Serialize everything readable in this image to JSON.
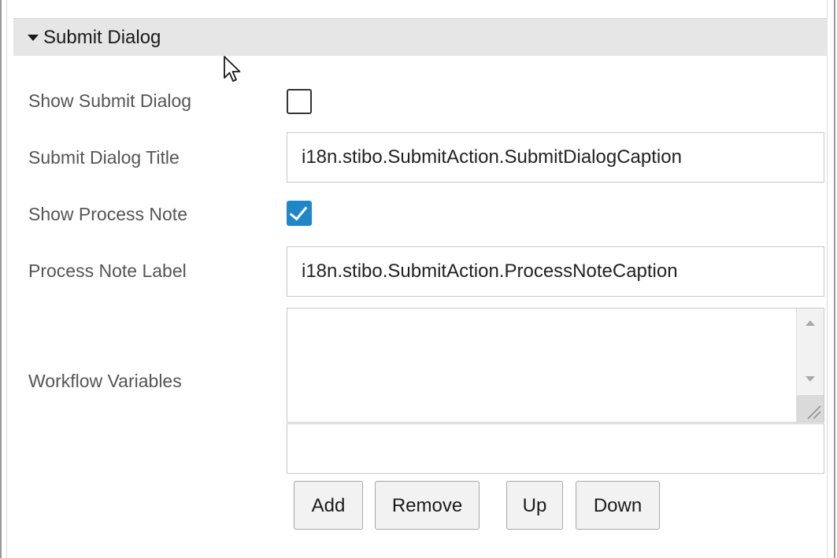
{
  "section": {
    "title": "Submit Dialog",
    "expanded": true
  },
  "fields": {
    "show_submit_dialog": {
      "label": "Show Submit Dialog",
      "checked": false
    },
    "submit_dialog_title": {
      "label": "Submit Dialog Title",
      "value": "i18n.stibo.SubmitAction.SubmitDialogCaption"
    },
    "show_process_note": {
      "label": "Show Process Note",
      "checked": true
    },
    "process_note_label": {
      "label": "Process Note Label",
      "value": "i18n.stibo.SubmitAction.ProcessNoteCaption"
    },
    "workflow_variables": {
      "label": "Workflow Variables",
      "items": [],
      "new_value": ""
    }
  },
  "buttons": {
    "add": "Add",
    "remove": "Remove",
    "up": "Up",
    "down": "Down"
  },
  "colors": {
    "header_bg": "#e6e6e6",
    "checkbox_checked": "#1f86c7",
    "label_text": "#555555"
  },
  "icons": {
    "expand": "triangle-down-icon",
    "checkmark": "checkmark-icon",
    "cursor": "mouse-pointer-icon"
  }
}
